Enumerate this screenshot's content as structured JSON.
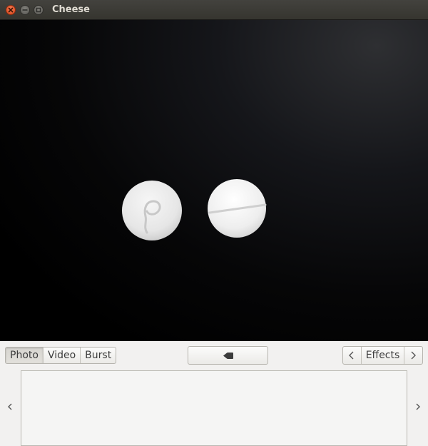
{
  "window": {
    "title": "Cheese"
  },
  "window_controls": {
    "close_icon": "close-icon",
    "minimize_icon": "minimize-icon",
    "maximize_icon": "maximize-icon"
  },
  "mode_switcher": {
    "items": [
      {
        "label": "Photo",
        "active": true
      },
      {
        "label": "Video",
        "active": false
      },
      {
        "label": "Burst",
        "active": false
      }
    ]
  },
  "capture": {
    "icon": "record-video-icon"
  },
  "effects": {
    "label": "Effects",
    "prev_icon": "chevron-left-icon",
    "next_icon": "chevron-right-icon"
  },
  "thumbnails": {
    "prev_icon": "chevron-left-icon",
    "next_icon": "chevron-right-icon",
    "items": []
  },
  "colors": {
    "titlebar": "#3c3b37",
    "close_button": "#e95420",
    "window_bg": "#f2f1f0",
    "viewport_bg": "#000000"
  }
}
